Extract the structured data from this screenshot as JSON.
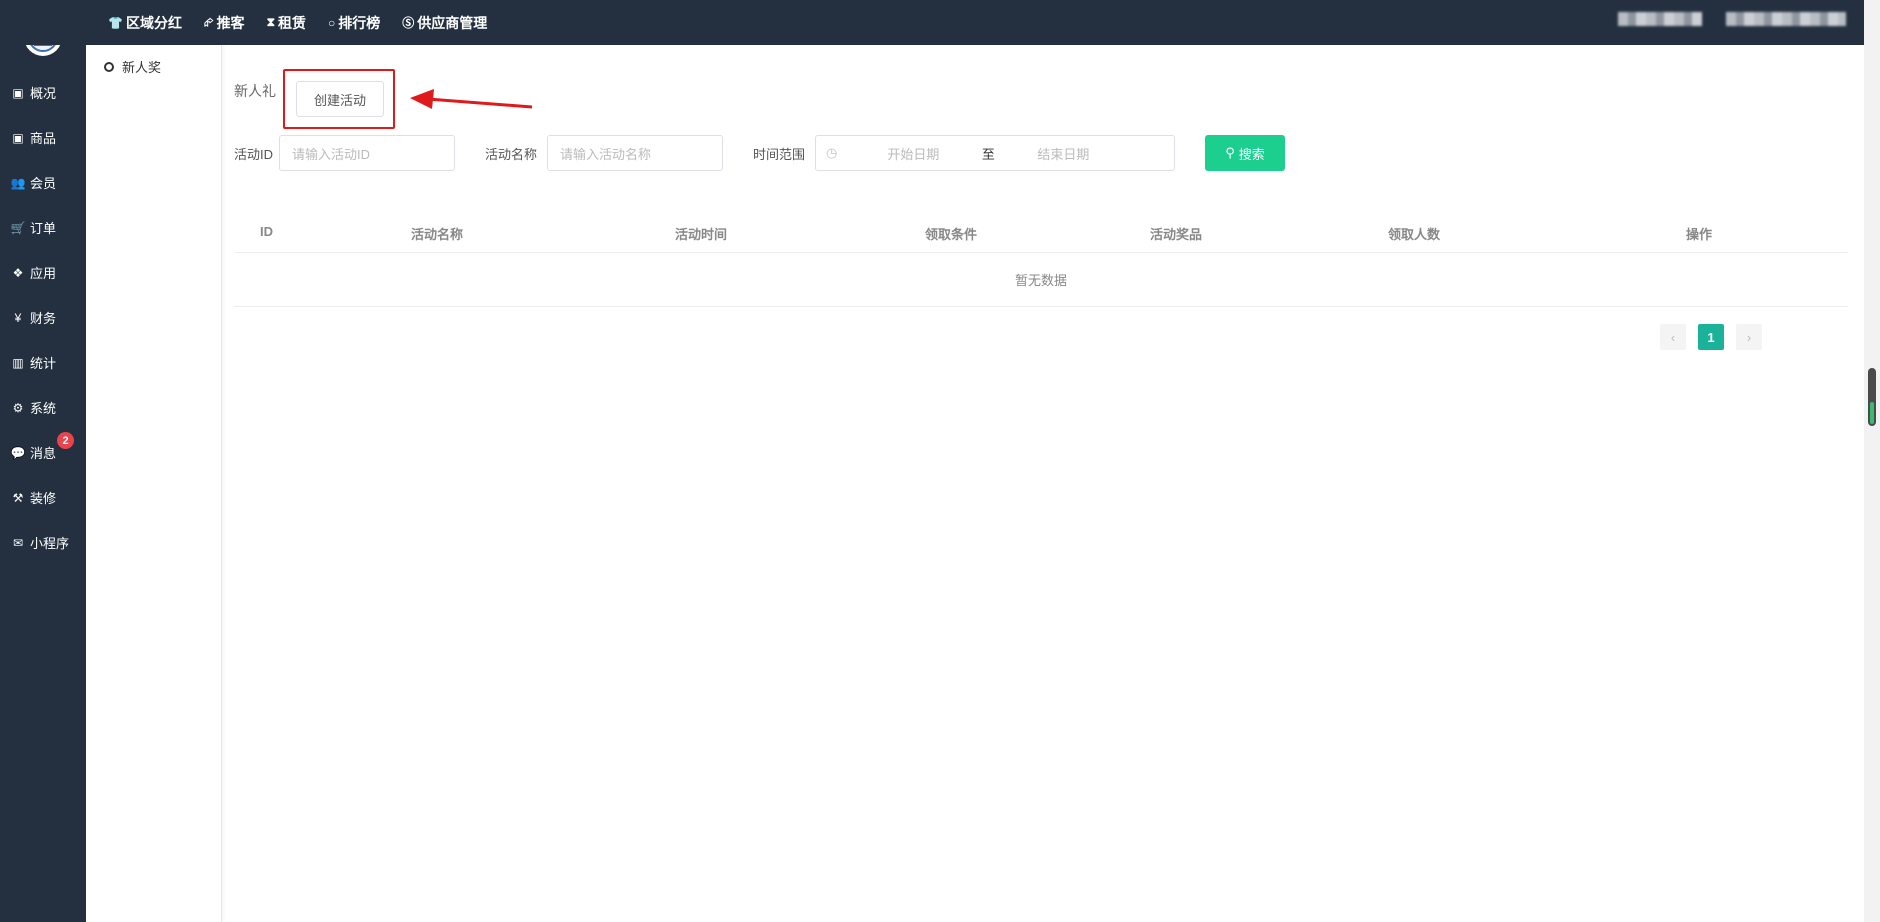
{
  "topnav": {
    "items": [
      {
        "icon": "person-icon",
        "glyph": "👕",
        "label": "区域分红"
      },
      {
        "icon": "share-icon",
        "glyph": "<",
        "label": "推客"
      },
      {
        "icon": "hourglass-icon",
        "glyph": "⌛",
        "label": "租赁"
      },
      {
        "icon": "circle-icon",
        "glyph": "○",
        "label": "排行榜"
      },
      {
        "icon": "skype-icon",
        "glyph": "Ⓢ",
        "label": "供应商管理"
      }
    ]
  },
  "sidebar": {
    "items": [
      {
        "icon": "box-icon",
        "glyph": "▣",
        "label": "概况"
      },
      {
        "icon": "box-icon",
        "glyph": "▣",
        "label": "商品"
      },
      {
        "icon": "users-icon",
        "glyph": "👥",
        "label": "会员"
      },
      {
        "icon": "cart-icon",
        "glyph": "🛒",
        "label": "订单"
      },
      {
        "icon": "cubes-icon",
        "glyph": "❖",
        "label": "应用"
      },
      {
        "icon": "yen-icon",
        "glyph": "¥",
        "label": "财务"
      },
      {
        "icon": "bar-chart-icon",
        "glyph": "▥",
        "label": "统计"
      },
      {
        "icon": "gears-icon",
        "glyph": "⚙",
        "label": "系统"
      },
      {
        "icon": "comment-icon",
        "glyph": "💬",
        "label": "消息",
        "badge": "2"
      },
      {
        "icon": "gavel-icon",
        "glyph": "⚒",
        "label": "装修"
      },
      {
        "icon": "wechat-icon",
        "glyph": "✉",
        "label": "小程序"
      }
    ]
  },
  "subside": {
    "items": [
      {
        "label": "新人奖"
      }
    ]
  },
  "page": {
    "title": "新人礼",
    "create_button": "创建活动"
  },
  "filters": {
    "id_label": "活动ID",
    "id_placeholder": "请输入活动ID",
    "name_label": "活动名称",
    "name_placeholder": "请输入活动名称",
    "time_label": "时间范围",
    "start_placeholder": "开始日期",
    "separator": "至",
    "end_placeholder": "结束日期",
    "search_button": "搜索"
  },
  "table": {
    "columns": [
      "ID",
      "活动名称",
      "活动时间",
      "领取条件",
      "活动奖品",
      "领取人数",
      "操作"
    ],
    "empty_text": "暂无数据"
  },
  "pagination": {
    "prev": "‹",
    "current": "1",
    "next": "›"
  },
  "colors": {
    "sidebar": "#243040",
    "accent": "#1ccf8e",
    "page_active": "#1ab39a",
    "highlight": "#e0191b",
    "badge": "#e8444d"
  }
}
